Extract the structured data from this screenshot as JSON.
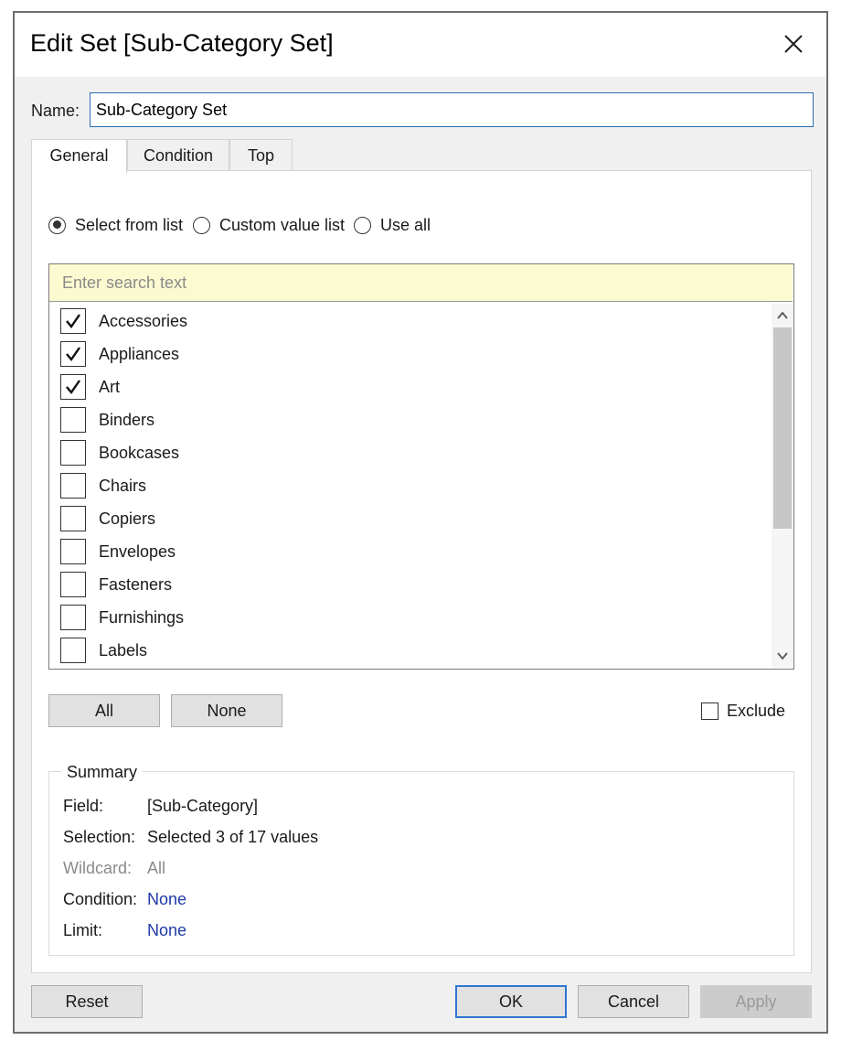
{
  "window": {
    "title": "Edit Set [Sub-Category Set]",
    "close_icon": "close-icon"
  },
  "name": {
    "label": "Name:",
    "value": "Sub-Category Set"
  },
  "tabs": [
    {
      "label": "General",
      "active": true
    },
    {
      "label": "Condition",
      "active": false
    },
    {
      "label": "Top",
      "active": false
    }
  ],
  "mode": {
    "options": [
      {
        "label": "Select from list",
        "checked": true
      },
      {
        "label": "Custom value list",
        "checked": false
      },
      {
        "label": "Use all",
        "checked": false
      }
    ]
  },
  "list": {
    "search_placeholder": "Enter search text",
    "items": [
      {
        "label": "Accessories",
        "checked": true
      },
      {
        "label": "Appliances",
        "checked": true
      },
      {
        "label": "Art",
        "checked": true
      },
      {
        "label": "Binders",
        "checked": false
      },
      {
        "label": "Bookcases",
        "checked": false
      },
      {
        "label": "Chairs",
        "checked": false
      },
      {
        "label": "Copiers",
        "checked": false
      },
      {
        "label": "Envelopes",
        "checked": false
      },
      {
        "label": "Fasteners",
        "checked": false
      },
      {
        "label": "Furnishings",
        "checked": false
      },
      {
        "label": "Labels",
        "checked": false
      }
    ]
  },
  "list_buttons": {
    "all": "All",
    "none": "None",
    "exclude": "Exclude"
  },
  "summary": {
    "legend": "Summary",
    "rows": [
      {
        "label": "Field:",
        "value": "[Sub-Category]"
      },
      {
        "label": "Selection:",
        "value": "Selected 3 of 17 values"
      },
      {
        "label": "Wildcard:",
        "value": "All"
      },
      {
        "label": "Condition:",
        "value": "None"
      },
      {
        "label": "Limit:",
        "value": "None"
      }
    ]
  },
  "footer": {
    "reset": "Reset",
    "ok": "OK",
    "cancel": "Cancel",
    "apply": "Apply"
  },
  "colors": {
    "accent": "#2f76d2",
    "search_bg": "#fcfad0",
    "link": "#1f3aa8"
  }
}
